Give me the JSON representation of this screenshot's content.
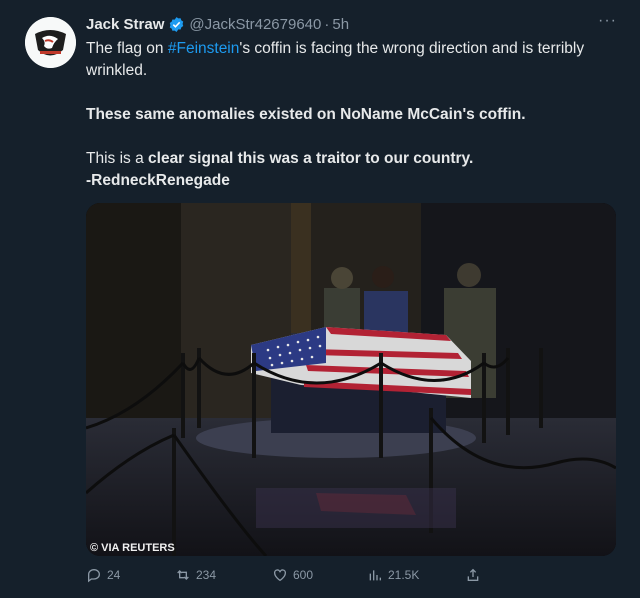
{
  "user": {
    "name": "Jack Straw",
    "handle": "@JackStr42679640",
    "separator": "·",
    "time": "5h"
  },
  "menu": {
    "more_label": "···"
  },
  "tweet": {
    "line1_pre": "The flag on ",
    "line1_hashtag": "#Feinstein",
    "line1_post": "'s coffin is facing the wrong direction and is terribly wrinkled.",
    "line2": "These same anomalies existed on NoName McCain's coffin.",
    "line3_pre": "This is a ",
    "line3_bold": "clear signal this was a traitor to our country.",
    "line4": "-RedneckRenegade"
  },
  "media": {
    "credit": "© VIA REUTERS"
  },
  "actions": {
    "replies": "24",
    "retweets": "234",
    "likes": "600",
    "views": "21.5K"
  },
  "colors": {
    "background": "#15202b",
    "text": "#e7e9ea",
    "muted": "#8b98a5",
    "link": "#1d9bf0",
    "verified": "#1d9bf0"
  }
}
